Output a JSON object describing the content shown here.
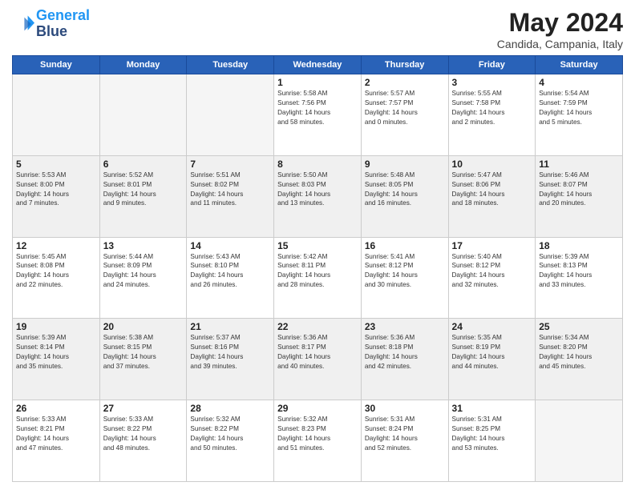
{
  "logo": {
    "line1": "General",
    "line2": "Blue"
  },
  "title": "May 2024",
  "location": "Candida, Campania, Italy",
  "days_of_week": [
    "Sunday",
    "Monday",
    "Tuesday",
    "Wednesday",
    "Thursday",
    "Friday",
    "Saturday"
  ],
  "weeks": [
    {
      "shaded": false,
      "days": [
        {
          "num": "",
          "info": ""
        },
        {
          "num": "",
          "info": ""
        },
        {
          "num": "",
          "info": ""
        },
        {
          "num": "1",
          "info": "Sunrise: 5:58 AM\nSunset: 7:56 PM\nDaylight: 14 hours\nand 58 minutes."
        },
        {
          "num": "2",
          "info": "Sunrise: 5:57 AM\nSunset: 7:57 PM\nDaylight: 14 hours\nand 0 minutes."
        },
        {
          "num": "3",
          "info": "Sunrise: 5:55 AM\nSunset: 7:58 PM\nDaylight: 14 hours\nand 2 minutes."
        },
        {
          "num": "4",
          "info": "Sunrise: 5:54 AM\nSunset: 7:59 PM\nDaylight: 14 hours\nand 5 minutes."
        }
      ]
    },
    {
      "shaded": true,
      "days": [
        {
          "num": "5",
          "info": "Sunrise: 5:53 AM\nSunset: 8:00 PM\nDaylight: 14 hours\nand 7 minutes."
        },
        {
          "num": "6",
          "info": "Sunrise: 5:52 AM\nSunset: 8:01 PM\nDaylight: 14 hours\nand 9 minutes."
        },
        {
          "num": "7",
          "info": "Sunrise: 5:51 AM\nSunset: 8:02 PM\nDaylight: 14 hours\nand 11 minutes."
        },
        {
          "num": "8",
          "info": "Sunrise: 5:50 AM\nSunset: 8:03 PM\nDaylight: 14 hours\nand 13 minutes."
        },
        {
          "num": "9",
          "info": "Sunrise: 5:48 AM\nSunset: 8:05 PM\nDaylight: 14 hours\nand 16 minutes."
        },
        {
          "num": "10",
          "info": "Sunrise: 5:47 AM\nSunset: 8:06 PM\nDaylight: 14 hours\nand 18 minutes."
        },
        {
          "num": "11",
          "info": "Sunrise: 5:46 AM\nSunset: 8:07 PM\nDaylight: 14 hours\nand 20 minutes."
        }
      ]
    },
    {
      "shaded": false,
      "days": [
        {
          "num": "12",
          "info": "Sunrise: 5:45 AM\nSunset: 8:08 PM\nDaylight: 14 hours\nand 22 minutes."
        },
        {
          "num": "13",
          "info": "Sunrise: 5:44 AM\nSunset: 8:09 PM\nDaylight: 14 hours\nand 24 minutes."
        },
        {
          "num": "14",
          "info": "Sunrise: 5:43 AM\nSunset: 8:10 PM\nDaylight: 14 hours\nand 26 minutes."
        },
        {
          "num": "15",
          "info": "Sunrise: 5:42 AM\nSunset: 8:11 PM\nDaylight: 14 hours\nand 28 minutes."
        },
        {
          "num": "16",
          "info": "Sunrise: 5:41 AM\nSunset: 8:12 PM\nDaylight: 14 hours\nand 30 minutes."
        },
        {
          "num": "17",
          "info": "Sunrise: 5:40 AM\nSunset: 8:12 PM\nDaylight: 14 hours\nand 32 minutes."
        },
        {
          "num": "18",
          "info": "Sunrise: 5:39 AM\nSunset: 8:13 PM\nDaylight: 14 hours\nand 33 minutes."
        }
      ]
    },
    {
      "shaded": true,
      "days": [
        {
          "num": "19",
          "info": "Sunrise: 5:39 AM\nSunset: 8:14 PM\nDaylight: 14 hours\nand 35 minutes."
        },
        {
          "num": "20",
          "info": "Sunrise: 5:38 AM\nSunset: 8:15 PM\nDaylight: 14 hours\nand 37 minutes."
        },
        {
          "num": "21",
          "info": "Sunrise: 5:37 AM\nSunset: 8:16 PM\nDaylight: 14 hours\nand 39 minutes."
        },
        {
          "num": "22",
          "info": "Sunrise: 5:36 AM\nSunset: 8:17 PM\nDaylight: 14 hours\nand 40 minutes."
        },
        {
          "num": "23",
          "info": "Sunrise: 5:36 AM\nSunset: 8:18 PM\nDaylight: 14 hours\nand 42 minutes."
        },
        {
          "num": "24",
          "info": "Sunrise: 5:35 AM\nSunset: 8:19 PM\nDaylight: 14 hours\nand 44 minutes."
        },
        {
          "num": "25",
          "info": "Sunrise: 5:34 AM\nSunset: 8:20 PM\nDaylight: 14 hours\nand 45 minutes."
        }
      ]
    },
    {
      "shaded": false,
      "days": [
        {
          "num": "26",
          "info": "Sunrise: 5:33 AM\nSunset: 8:21 PM\nDaylight: 14 hours\nand 47 minutes."
        },
        {
          "num": "27",
          "info": "Sunrise: 5:33 AM\nSunset: 8:22 PM\nDaylight: 14 hours\nand 48 minutes."
        },
        {
          "num": "28",
          "info": "Sunrise: 5:32 AM\nSunset: 8:22 PM\nDaylight: 14 hours\nand 50 minutes."
        },
        {
          "num": "29",
          "info": "Sunrise: 5:32 AM\nSunset: 8:23 PM\nDaylight: 14 hours\nand 51 minutes."
        },
        {
          "num": "30",
          "info": "Sunrise: 5:31 AM\nSunset: 8:24 PM\nDaylight: 14 hours\nand 52 minutes."
        },
        {
          "num": "31",
          "info": "Sunrise: 5:31 AM\nSunset: 8:25 PM\nDaylight: 14 hours\nand 53 minutes."
        },
        {
          "num": "",
          "info": ""
        }
      ]
    }
  ]
}
